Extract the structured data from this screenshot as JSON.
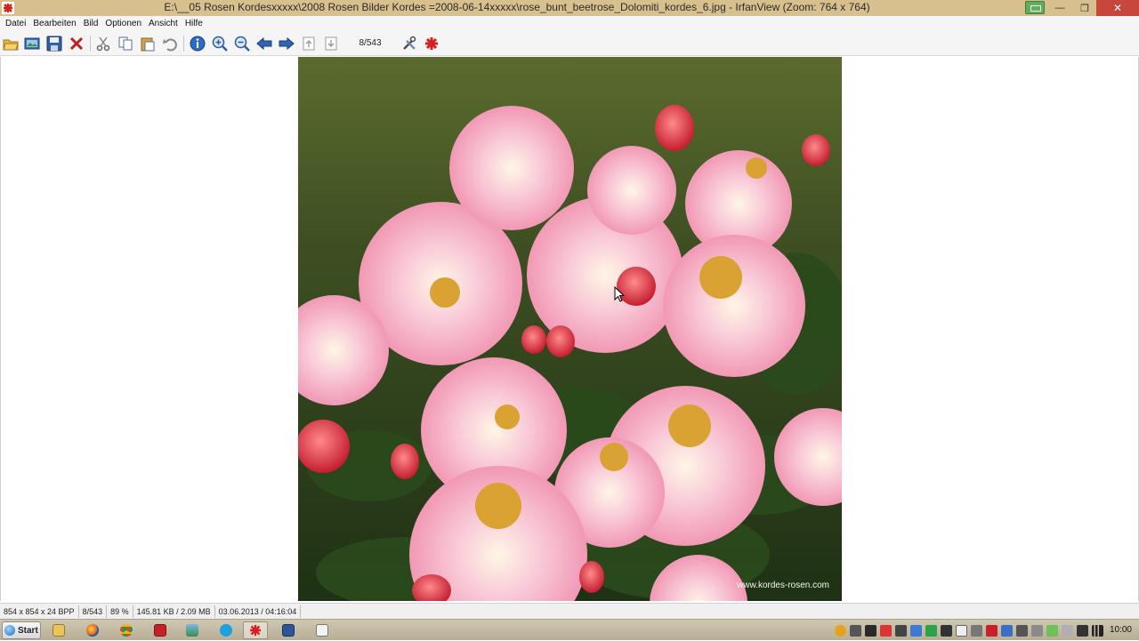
{
  "window": {
    "title": "E:\\__05 Rosen Kordesxxxxx\\2008 Rosen Bilder Kordes =2008-06-14xxxxx\\rose_bunt_beetrose_Dolomiti_kordes_6.jpg - IrfanView (Zoom: 764 x 764)"
  },
  "menu": {
    "items": [
      "Datei",
      "Bearbeiten",
      "Bild",
      "Optionen",
      "Ansicht",
      "Hilfe"
    ]
  },
  "toolbar": {
    "page_counter": "8/543",
    "icons": [
      "open-icon",
      "slideshow-icon",
      "save-icon",
      "delete-icon",
      "cut-icon",
      "copy-icon",
      "paste-icon",
      "undo-icon",
      "info-icon",
      "zoom-in-icon",
      "zoom-out-icon",
      "previous-icon",
      "next-icon",
      "first-page-icon",
      "last-page-icon",
      "settings-icon",
      "irfanview-icon"
    ]
  },
  "image": {
    "watermark": "www.kordes-rosen.com"
  },
  "statusbar": {
    "dimensions": "854 x 854 x 24 BPP",
    "index": "8/543",
    "zoom": "89 %",
    "size": "145.81 KB / 2.09 MB",
    "datetime": "03.06.2013 / 04:16:04"
  },
  "taskbar": {
    "start_label": "Start",
    "clock": "10:00"
  },
  "colors": {
    "titlebar": "#d7c08e",
    "close_button": "#c8473c",
    "taskbar": "#c4bba2"
  }
}
